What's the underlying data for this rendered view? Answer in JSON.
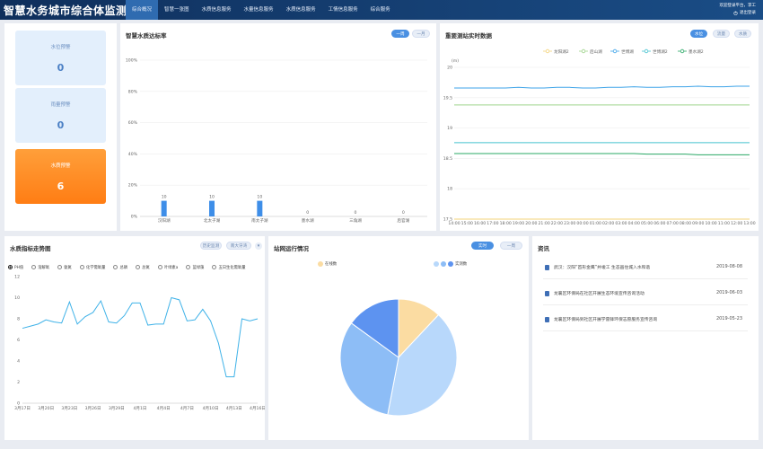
{
  "header": {
    "title": "智慧水务城市综合体监测系统",
    "nav": [
      "综合概况",
      "智慧一张图",
      "水质信息服务",
      "水量信息服务",
      "水质信息服务",
      "工情信息服务",
      "综合服务"
    ],
    "active_nav": 0,
    "welcome": "欢迎登录平台，李工",
    "logout": "退出登录"
  },
  "alerts": [
    {
      "label": "水位预警",
      "value": "0"
    },
    {
      "label": "雨量预警",
      "value": "0"
    },
    {
      "label": "水质预警",
      "value": "6"
    }
  ],
  "rate_panel": {
    "title": "智慧水质达标率",
    "buttons": [
      "一周",
      "一月"
    ],
    "active": 0
  },
  "realtime_panel": {
    "title": "重要测站实时数据",
    "buttons": [
      "水位",
      "流量",
      "水质"
    ],
    "active": 0
  },
  "trend_panel": {
    "title": "水质指标走势图",
    "buttons": [
      "历史监测",
      "南大牙湾"
    ],
    "indicators": [
      "PH值",
      "溶解氧",
      "氨氮",
      "化学需氧量",
      "总磷",
      "总氮",
      "叶绿素a",
      "蓝绿藻",
      "五日生化需氧量"
    ],
    "selected": 0
  },
  "station_panel": {
    "title": "站网运行情况",
    "buttons": [
      "实时",
      "一周"
    ],
    "active": 0,
    "legend": [
      "在线数",
      "",
      "",
      "实测数"
    ]
  },
  "news_panel": {
    "title": "资讯",
    "items": [
      {
        "text": "武汉：汉阳“首形金鹰”并竣工 生态画住城入水和谐",
        "date": "2019-08-08"
      },
      {
        "text": "龙襄区环保局在社区开展生态环境宣传咨询活动",
        "date": "2019-06-03"
      },
      {
        "text": "龙襄区环保局到社区开展学雷锋环保志愿服务宣传咨询",
        "date": "2019-05-23"
      }
    ]
  },
  "chart_data": [
    {
      "type": "bar",
      "title": "智慧水质达标率",
      "categories": [
        "汉阳湖",
        "北太子湖",
        "南太子湖",
        "墨水湖",
        "三角湖",
        "后官湖"
      ],
      "values": [
        10,
        10,
        10,
        0,
        0,
        0
      ],
      "data_labels": [
        "10",
        "10",
        "10",
        "0",
        "0",
        "0"
      ],
      "yticks": [
        "0%",
        "20%",
        "40%",
        "60%",
        "80%",
        "100%"
      ],
      "ylim": [
        0,
        100
      ],
      "color": "#3e8ee8"
    },
    {
      "type": "line",
      "title": "重要测站实时数据",
      "ylabel": "(m)",
      "ylim": [
        17.5,
        20
      ],
      "yticks": [
        "17.5",
        "18",
        "18.5",
        "19",
        "19.5",
        "20"
      ],
      "x": [
        "14:00",
        "15:00",
        "16:00",
        "17:00",
        "18:00",
        "19:00",
        "20:00",
        "21:00",
        "22:00",
        "23:00",
        "00:00",
        "01:00",
        "02:00",
        "03:00",
        "04:00",
        "05:00",
        "06:00",
        "07:00",
        "08:00",
        "09:00",
        "10:00",
        "11:00",
        "12:00",
        "13:00"
      ],
      "series": [
        {
          "name": "龙阳湖2",
          "color": "#f3d37a",
          "values": [
            17.5,
            17.5,
            17.5,
            17.5,
            17.5,
            17.5,
            17.5,
            17.5,
            17.5,
            17.5,
            17.5,
            17.5,
            17.5,
            17.5,
            17.5,
            17.5,
            17.5,
            17.5,
            17.5,
            17.5,
            17.5,
            17.5,
            17.5,
            17.5
          ]
        },
        {
          "name": "后山湖",
          "color": "#9ed38a",
          "values": [
            19.38,
            19.38,
            19.38,
            19.38,
            19.38,
            19.38,
            19.38,
            19.38,
            19.38,
            19.38,
            19.38,
            19.38,
            19.38,
            19.38,
            19.38,
            19.38,
            19.38,
            19.38,
            19.38,
            19.38,
            19.38,
            19.38,
            19.38,
            19.38
          ]
        },
        {
          "name": "世博湖",
          "color": "#3da3e8",
          "values": [
            19.66,
            19.66,
            19.66,
            19.66,
            19.66,
            19.67,
            19.66,
            19.66,
            19.67,
            19.67,
            19.66,
            19.66,
            19.67,
            19.67,
            19.68,
            19.67,
            19.67,
            19.68,
            19.68,
            19.69,
            19.68,
            19.68,
            19.69,
            19.69
          ]
        },
        {
          "name": "世博湖2",
          "color": "#45c2cf",
          "values": [
            18.76,
            18.76,
            18.76,
            18.76,
            18.76,
            18.76,
            18.76,
            18.76,
            18.76,
            18.76,
            18.76,
            18.76,
            18.76,
            18.76,
            18.76,
            18.76,
            18.76,
            18.76,
            18.76,
            18.76,
            18.76,
            18.76,
            18.76,
            18.76
          ]
        },
        {
          "name": "墨水湖2",
          "color": "#2aa866",
          "values": [
            18.58,
            18.58,
            18.58,
            18.58,
            18.58,
            18.58,
            18.58,
            18.58,
            18.58,
            18.58,
            18.58,
            18.58,
            18.58,
            18.58,
            18.58,
            18.57,
            18.57,
            18.57,
            18.57,
            18.56,
            18.56,
            18.56,
            18.56,
            18.56
          ]
        }
      ]
    },
    {
      "type": "line",
      "title": "水质指标走势图",
      "series_name": "PH值",
      "ylim": [
        0,
        12
      ],
      "yticks": [
        "0",
        "2",
        "4",
        "6",
        "8",
        "10",
        "12"
      ],
      "x": [
        "3月17日",
        "3月18日",
        "3月19日",
        "3月20日",
        "3月21日",
        "3月22日",
        "3月23日",
        "3月24日",
        "3月25日",
        "3月26日",
        "3月27日",
        "3月28日",
        "3月29日",
        "3月30日",
        "3月31日",
        "4月1日",
        "4月2日",
        "4月3日",
        "4月4日",
        "4月5日",
        "4月6日",
        "4月7日",
        "4月8日",
        "4月9日",
        "4月10日",
        "4月11日",
        "4月12日",
        "4月13日",
        "4月14日",
        "4月15日",
        "4月16日"
      ],
      "xticks": [
        "3月17日",
        "3月20日",
        "3月23日",
        "3月26日",
        "3月29日",
        "4月1日",
        "4月4日",
        "4月7日",
        "4月10日",
        "4月13日",
        "4月16日"
      ],
      "values": [
        7.1,
        7.3,
        7.5,
        7.9,
        7.7,
        7.6,
        9.6,
        7.5,
        8.2,
        8.6,
        9.7,
        7.7,
        7.6,
        8.3,
        9.5,
        9.5,
        7.4,
        7.5,
        7.5,
        10.0,
        9.8,
        7.8,
        7.9,
        8.9,
        7.8,
        5.7,
        2.5,
        2.5,
        8.0,
        7.8,
        8.0
      ],
      "color": "#3fb2e8"
    },
    {
      "type": "pie",
      "title": "站网运行情况",
      "slices": [
        {
          "label": "在线数",
          "value": 12,
          "color": "#fbdca2"
        },
        {
          "label": "",
          "value": 41,
          "color": "#b8d8fb"
        },
        {
          "label": "",
          "value": 32,
          "color": "#8dbdf6"
        },
        {
          "label": "实测数",
          "value": 15,
          "color": "#5d93f0"
        }
      ]
    }
  ]
}
